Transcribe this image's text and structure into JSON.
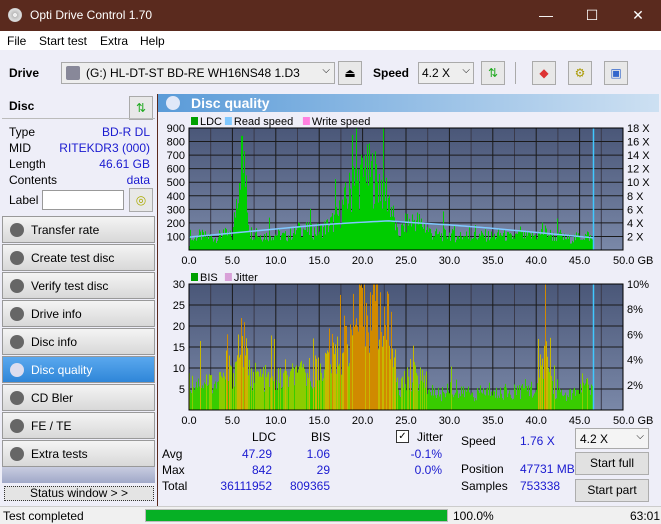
{
  "window": {
    "title": "Opti Drive Control 1.70",
    "minimize": "—",
    "maximize": "☐",
    "close": "✕"
  },
  "menu": [
    "File",
    "Start test",
    "Extra",
    "Help"
  ],
  "toolbar": {
    "drive_label": "Drive",
    "drive_value": "(G:)  HL-DT-ST BD-RE  WH16NS48 1.D3",
    "speed_label": "Speed",
    "speed_value": "4.2 X"
  },
  "disc": {
    "header": "Disc",
    "rows": [
      {
        "label": "Type",
        "value": "BD-R DL"
      },
      {
        "label": "MID",
        "value": "RITEKDR3 (000)"
      },
      {
        "label": "Length",
        "value": "46.61 GB"
      },
      {
        "label": "Contents",
        "value": "data"
      }
    ],
    "label_field": "Label",
    "label_value": ""
  },
  "nav": [
    {
      "label": "Transfer rate",
      "active": false
    },
    {
      "label": "Create test disc",
      "active": false
    },
    {
      "label": "Verify test disc",
      "active": false
    },
    {
      "label": "Drive info",
      "active": false
    },
    {
      "label": "Disc info",
      "active": false
    },
    {
      "label": "Disc quality",
      "active": true
    },
    {
      "label": "CD Bler",
      "active": false
    },
    {
      "label": "FE / TE",
      "active": false
    },
    {
      "label": "Extra tests",
      "active": false
    }
  ],
  "status_window_btn": "Status window > >",
  "main_title": "Disc quality",
  "chart_data": [
    {
      "type": "bar",
      "title": "LDC",
      "legend": [
        {
          "name": "LDC",
          "color": "#00a000"
        },
        {
          "name": "Read speed",
          "color": "#80c8ff"
        },
        {
          "name": "Write speed",
          "color": "#ff80e0"
        }
      ],
      "xlabel": "GB",
      "xlim": [
        0,
        50
      ],
      "xticks": [
        "0.0",
        "5.0",
        "10.0",
        "15.0",
        "20.0",
        "25.0",
        "30.0",
        "35.0",
        "40.0",
        "45.0",
        "50.0 GB"
      ],
      "ylim": [
        0,
        900
      ],
      "yticks": [
        "100",
        "200",
        "300",
        "400",
        "500",
        "600",
        "700",
        "800",
        "900"
      ],
      "y2ticks": [
        "2 X",
        "4 X",
        "6 X",
        "8 X",
        "10 X",
        "12 X",
        "14 X",
        "16 X",
        "18 X"
      ],
      "y2lim": [
        0,
        18
      ],
      "series": [
        {
          "name": "LDC",
          "x": [
            0,
            1,
            2,
            3,
            4,
            5,
            6,
            7,
            8,
            9,
            10,
            11,
            12,
            13,
            14,
            15,
            16,
            17,
            18,
            19,
            20,
            21,
            22,
            23,
            24,
            25,
            26,
            27,
            28,
            29,
            30,
            31,
            32,
            33,
            34,
            35,
            36,
            37,
            38,
            39,
            40,
            41,
            42,
            43,
            44,
            45,
            46,
            46.6
          ],
          "values": [
            60,
            120,
            110,
            100,
            130,
            110,
            842,
            150,
            120,
            120,
            130,
            110,
            140,
            180,
            150,
            160,
            200,
            260,
            400,
            550,
            600,
            620,
            560,
            430,
            120,
            220,
            250,
            200,
            130,
            120,
            130,
            100,
            120,
            110,
            120,
            110,
            130,
            100,
            120,
            110,
            120,
            150,
            110,
            100,
            90,
            110,
            120,
            60
          ]
        },
        {
          "name": "Read speed",
          "x": [
            0,
            5,
            10,
            15,
            20,
            23,
            25,
            30,
            35,
            40,
            45,
            46.6
          ],
          "values": [
            1.9,
            2.5,
            3.1,
            3.7,
            4.1,
            4.3,
            4.1,
            3.7,
            3.2,
            2.6,
            2.0,
            1.8
          ]
        }
      ],
      "marker_x": 46.6
    },
    {
      "type": "bar",
      "title": "BIS",
      "legend": [
        {
          "name": "BIS",
          "color": "#00a000"
        },
        {
          "name": "Jitter",
          "color": "#d8a0d8"
        }
      ],
      "xlabel": "GB",
      "xlim": [
        0,
        50
      ],
      "xticks": [
        "0.0",
        "5.0",
        "10.0",
        "15.0",
        "20.0",
        "25.0",
        "30.0",
        "35.0",
        "40.0",
        "45.0",
        "50.0 GB"
      ],
      "ylim": [
        0,
        30
      ],
      "yticks": [
        "5",
        "10",
        "15",
        "20",
        "25",
        "30"
      ],
      "y2ticks": [
        "2%",
        "4%",
        "6%",
        "8%",
        "10%"
      ],
      "y2lim": [
        0,
        10
      ],
      "series": [
        {
          "name": "BIS",
          "x": [
            0,
            1,
            2,
            3,
            4,
            5,
            6,
            7,
            8,
            9,
            10,
            11,
            12,
            13,
            14,
            15,
            16,
            17,
            18,
            19,
            20,
            21,
            22,
            23,
            24,
            25,
            26,
            27,
            28,
            29,
            30,
            31,
            32,
            33,
            34,
            35,
            36,
            37,
            38,
            39,
            40,
            41,
            42,
            43,
            44,
            45,
            46,
            46.6
          ],
          "values": [
            7,
            8,
            8,
            7,
            8,
            9,
            20,
            9,
            9,
            8,
            8,
            8,
            9,
            9,
            10,
            11,
            13,
            15,
            18,
            22,
            25,
            26,
            24,
            23,
            5,
            8,
            9,
            8,
            5,
            4,
            6,
            4,
            5,
            4,
            5,
            4,
            5,
            4,
            5,
            6,
            5,
            17,
            5,
            4,
            4,
            5,
            6,
            5
          ]
        }
      ],
      "marker_x": 46.6
    }
  ],
  "stats": {
    "col_ldc": "LDC",
    "col_bis": "BIS",
    "jitter_label": "Jitter",
    "jitter_checked": true,
    "rows": [
      {
        "label": "Avg",
        "ldc": "47.29",
        "bis": "1.06",
        "jitter": "-0.1%"
      },
      {
        "label": "Max",
        "ldc": "842",
        "bis": "29",
        "jitter": "0.0%"
      },
      {
        "label": "Total",
        "ldc": "36111952",
        "bis": "809365",
        "jitter": ""
      }
    ],
    "speed_label": "Speed",
    "speed_value": "1.76 X",
    "position_label": "Position",
    "position_value": "47731 MB",
    "samples_label": "Samples",
    "samples_value": "753338",
    "speed_select": "4.2 X",
    "start_full": "Start full",
    "start_part": "Start part"
  },
  "statusbar": {
    "text": "Test completed",
    "progress": 100.0,
    "progress_text": "100.0%",
    "time": "63:01"
  },
  "colors": {
    "accent": "#2f86d8",
    "progress": "#06b025",
    "titlebar": "#5a2a1e"
  }
}
